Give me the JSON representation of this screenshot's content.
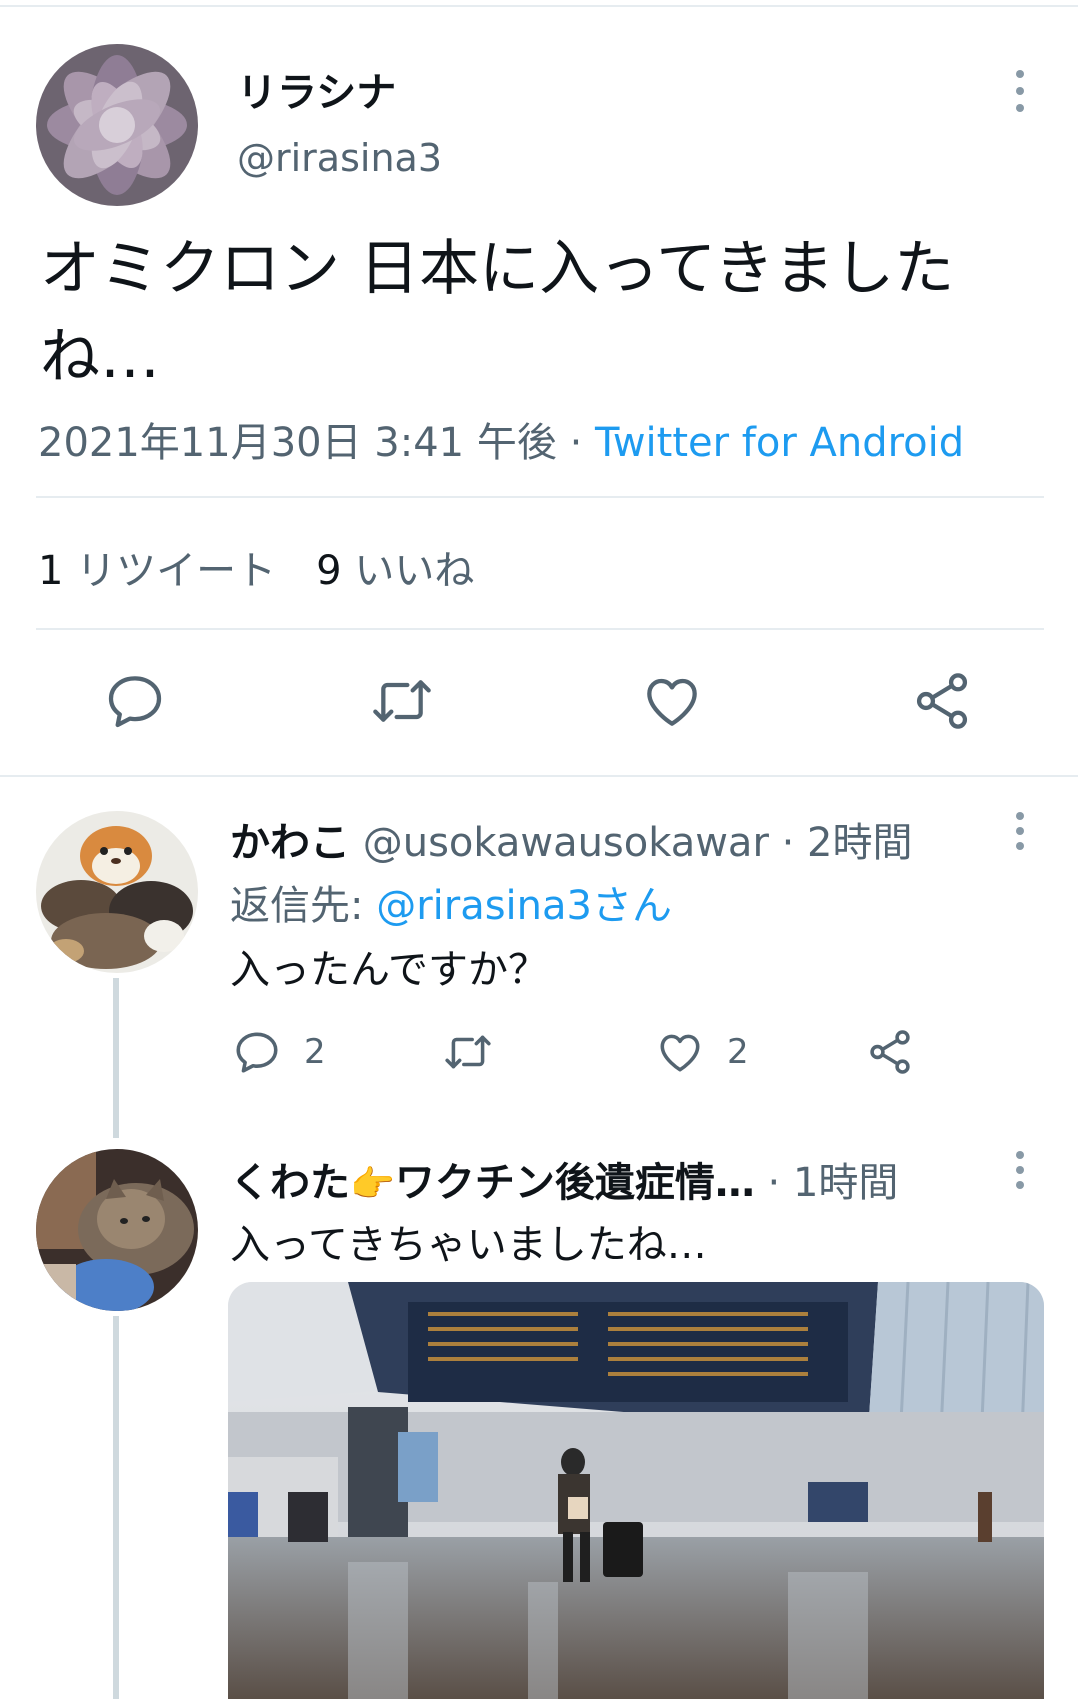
{
  "main_tweet": {
    "display_name": "リラシナ",
    "handle": "@rirasina3",
    "text": "オミクロン 日本に入ってきましたね…",
    "timestamp": "2021年11月30日 3:41 午後",
    "separator": " · ",
    "source": "Twitter for Android",
    "retweet_count": "1",
    "retweet_label": "リツイート",
    "like_count": "9",
    "like_label": "いいね",
    "actions": [
      "reply-icon",
      "retweet-icon",
      "like-icon",
      "share-icon"
    ]
  },
  "replies": [
    {
      "display_name": "かわこ",
      "handle": "@usokawausokawar",
      "time": " · 2時間",
      "reply_to_label": "返信先: ",
      "reply_to_mention": "@rirasina3さん",
      "text": "入ったんですか？",
      "reply_count": "2",
      "like_count": "2"
    },
    {
      "display_name_a": "くわた",
      "display_name_b": "ワクチン後遺症情…",
      "time": " · 1時間",
      "text": "入ってきちゃいましたね…",
      "emoji": "👉"
    }
  ],
  "colors": {
    "accent": "#1d9bf0",
    "secondary_text": "#536471",
    "divider": "#e6ecf0"
  }
}
